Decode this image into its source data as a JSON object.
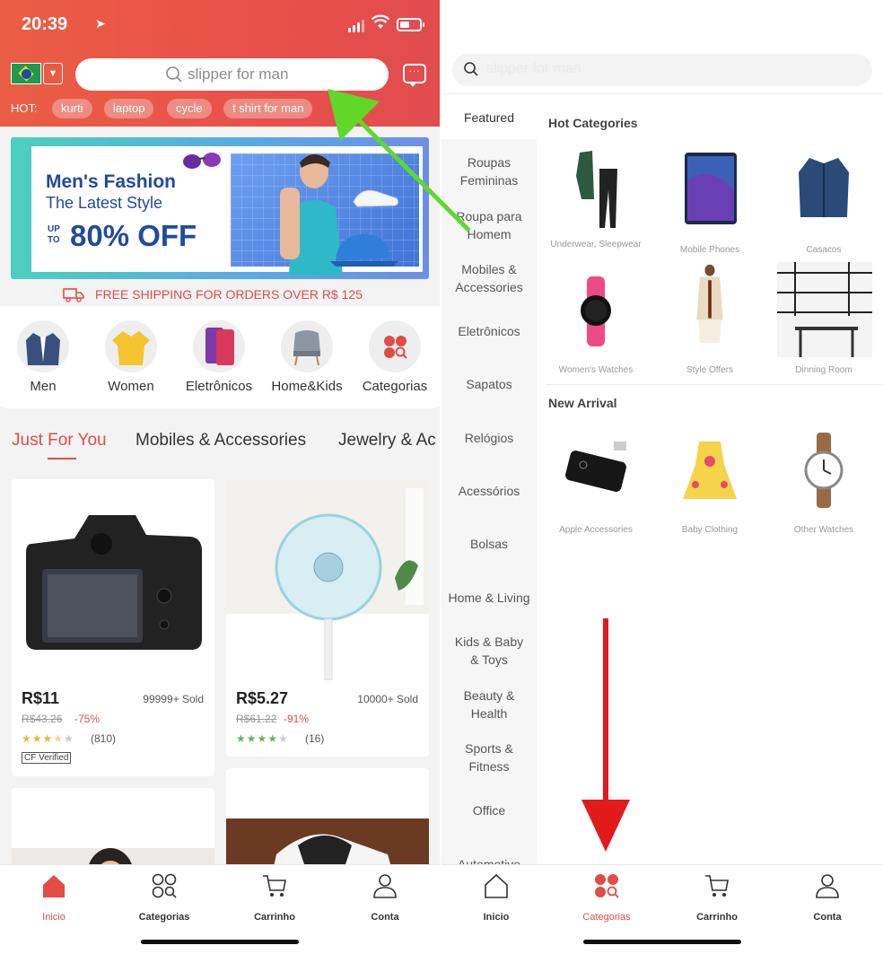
{
  "left": {
    "status": {
      "time": "20:39"
    },
    "search": {
      "placeholder": "slipper for man"
    },
    "hot": {
      "label": "HOT:",
      "chips": [
        "kurti",
        "laptop",
        "cycle",
        "t shirt for man"
      ]
    },
    "banner": {
      "title": "Men's Fashion",
      "subtitle": "The Latest Style",
      "upto": "UP TO",
      "offer": "80% OFF"
    },
    "shipping": "FREE SHIPPING FOR ORDERS OVER R$ 125",
    "categories": [
      "Men",
      "Women",
      "Eletrônicos",
      "Home&Kids",
      "Categorias"
    ],
    "tabs": [
      "Just For You",
      "Mobiles & Accessories",
      "Jewelry & Ac"
    ],
    "products": [
      {
        "price": "R$11",
        "sold": "99999+ Sold",
        "old": "R$43.26",
        "discount": "-75%",
        "rating": 3.5,
        "reviews": "(810)",
        "badge": "CF Verified"
      },
      {
        "price": "R$5.27",
        "sold": "10000+ Sold",
        "old": "R$61.22",
        "discount": "-91%",
        "rating": 4,
        "reviews": "(16)"
      }
    ],
    "nav": [
      "Inicio",
      "Categorias",
      "Carrinho",
      "Conta"
    ],
    "nav_active": "Inicio"
  },
  "right": {
    "search": {
      "placeholder": "slipper for man"
    },
    "sidebar": [
      "Featured",
      "Roupas Femininas",
      "Roupa para Homem",
      "Mobiles & Accessories",
      "Eletrônicos",
      "Sapatos",
      "Relógios",
      "Acessórios",
      "Bolsas",
      "Home & Living",
      "Kids & Baby & Toys",
      "Beauty & Health",
      "Sports & Fitness",
      "Office",
      "Automotive"
    ],
    "sidebar_active": "Featured",
    "hot_title": "Hot Categories",
    "hot_items": [
      "Underwear, Sleepwear",
      "Mobile Phones",
      "Casacos",
      "Women's Watches",
      "Style Offers",
      "Dinning Room"
    ],
    "new_title": "New Arrival",
    "new_items": [
      "Apple Accessories",
      "Baby Clothing",
      "Other Watches"
    ],
    "nav": [
      "Inicio",
      "Categorias",
      "Carrinho",
      "Conta"
    ],
    "nav_active": "Categorias"
  },
  "colors": {
    "accent": "#e24c45",
    "header": "#e9504a",
    "green_arrow": "#5fd82a",
    "red_arrow": "#e21a1a"
  }
}
